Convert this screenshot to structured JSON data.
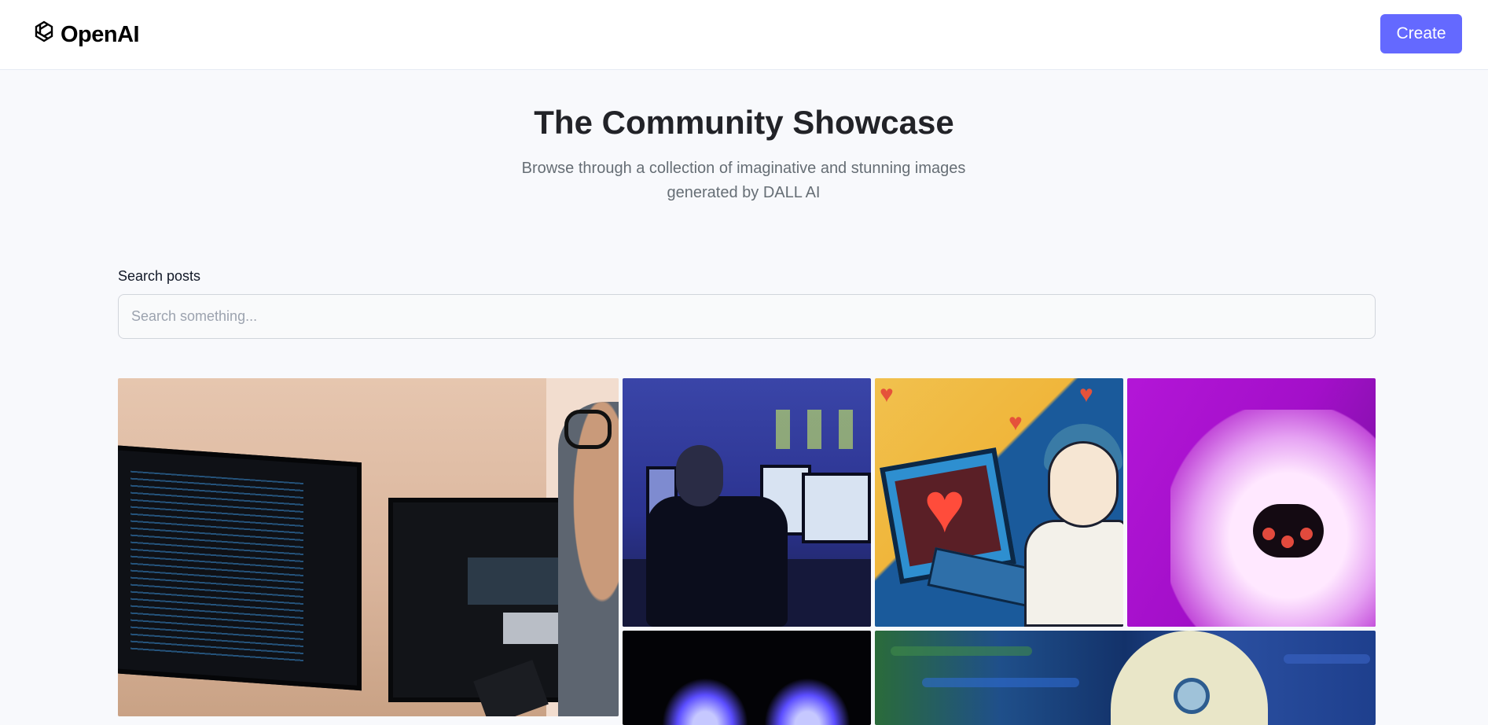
{
  "header": {
    "logo_text": "OpenAI",
    "logo_icon": "openai-logo-icon",
    "create_label": "Create",
    "accent_color": "#6469ff"
  },
  "hero": {
    "title": "The Community Showcase",
    "subtitle": "Browse through a collection of imaginative and stunning images generated by DALL AI"
  },
  "search": {
    "label": "Search posts",
    "placeholder": "Search something...",
    "value": ""
  },
  "gallery": {
    "items": [
      {
        "name": "developer-monitors-image"
      },
      {
        "name": "man-at-monitors-image"
      },
      {
        "name": "cartoon-heart-laptop-image"
      },
      {
        "name": "purple-furry-creature-image"
      },
      {
        "name": "dark-blue-glow-image"
      },
      {
        "name": "skull-painting-image"
      }
    ]
  }
}
